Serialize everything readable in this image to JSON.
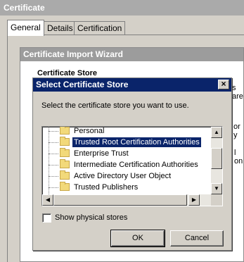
{
  "certificate_window": {
    "title": "Certificate",
    "tabs": [
      {
        "label": "General",
        "active": true
      },
      {
        "label": "Details",
        "active": false
      },
      {
        "label": "Certification Path",
        "active": false
      }
    ]
  },
  "import_wizard": {
    "title": "Certificate Import Wizard",
    "heading": "Certificate Store",
    "clipped_text_1": "s are",
    "clipped_text_2": "or y",
    "clipped_text_3": "l on"
  },
  "select_store_dialog": {
    "title": "Select Certificate Store",
    "close_label": "×",
    "instruction": "Select the certificate store you want to use.",
    "stores": [
      {
        "label": "Personal",
        "selected": false
      },
      {
        "label": "Trusted Root Certification Authorities",
        "selected": true
      },
      {
        "label": "Enterprise Trust",
        "selected": false
      },
      {
        "label": "Intermediate Certification Authorities",
        "selected": false
      },
      {
        "label": "Active Directory User Object",
        "selected": false
      },
      {
        "label": "Trusted Publishers",
        "selected": false
      }
    ],
    "show_physical_label": "Show physical stores",
    "show_physical_checked": false,
    "ok_label": "OK",
    "cancel_label": "Cancel"
  },
  "icons": {
    "folder": "folder-icon",
    "scroll_up": "▲",
    "scroll_down": "▼",
    "scroll_left": "◀",
    "scroll_right": "▶"
  },
  "colors": {
    "selection": "#0a246a",
    "dialog_title": "#0a246a",
    "inactive_title": "#9c9c9c",
    "face": "#d4d0c8"
  }
}
